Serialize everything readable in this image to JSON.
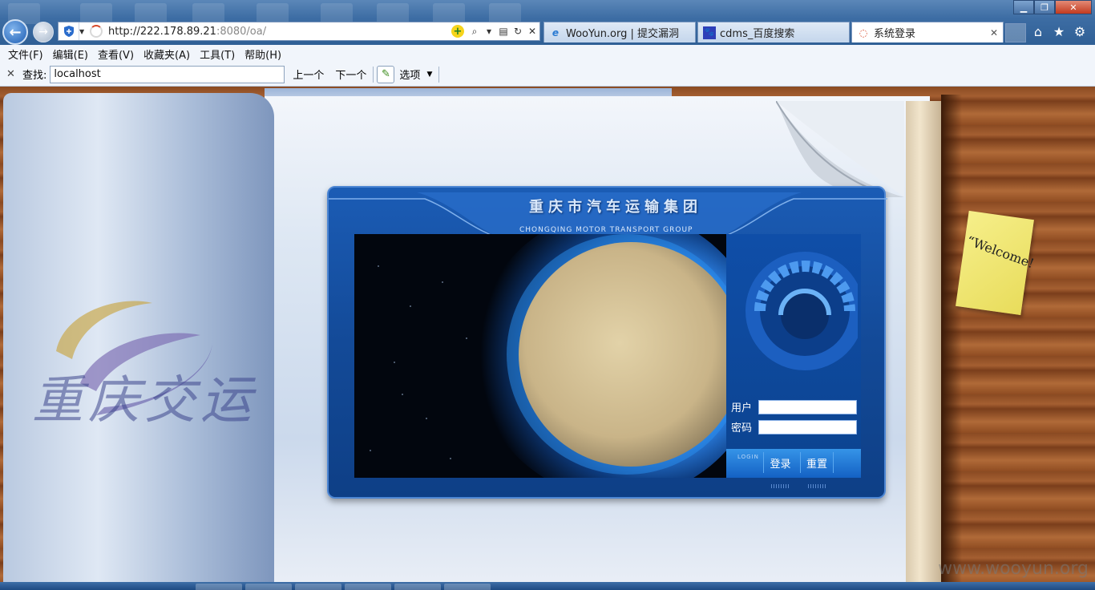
{
  "window": {
    "minimize": "▁",
    "maximize": "❐",
    "close": "✕"
  },
  "nav": {
    "back_icon": "←",
    "forward_icon": "→"
  },
  "address": {
    "url_host": "http://222.178.89.21",
    "url_rest": ":8080/oa/",
    "search_icon": "⌕",
    "refresh_icon": "↻",
    "stop_icon": "✕",
    "compat_icon": "+"
  },
  "tabs": [
    {
      "icon": "e",
      "label": "WooYun.org | 提交漏洞"
    },
    {
      "icon": "🐾",
      "label": "cdms_百度搜索"
    },
    {
      "icon": "◌",
      "label": "系统登录",
      "active": true
    }
  ],
  "toolbar_icons": {
    "home": "⌂",
    "favorites": "★",
    "tools": "⚙"
  },
  "menu": [
    "文件(F)",
    "编辑(E)",
    "查看(V)",
    "收藏夹(A)",
    "工具(T)",
    "帮助(H)"
  ],
  "find_bar": {
    "close": "✕",
    "label": "查找:",
    "value": "localhost",
    "prev": "上一个",
    "next": "下一个",
    "options": "选项",
    "options_arrow": "▼"
  },
  "page": {
    "company_cn": "重庆市汽车运输集团",
    "company_en": "CHONGQING MOTOR TRANSPORT GROUP",
    "cover_calligraphy": "重庆交运",
    "welcome": "“Welcome!",
    "login": {
      "tag": "LOGIN",
      "user_label": "用户",
      "password_label": "密码",
      "user_value": "",
      "password_value": "",
      "submit": "登录",
      "reset": "重置"
    },
    "watermark": "www.wooyun.org"
  },
  "colors": {
    "panel": "#1b5cb5",
    "accent": "#3594e8",
    "wood": "#a45f31"
  }
}
